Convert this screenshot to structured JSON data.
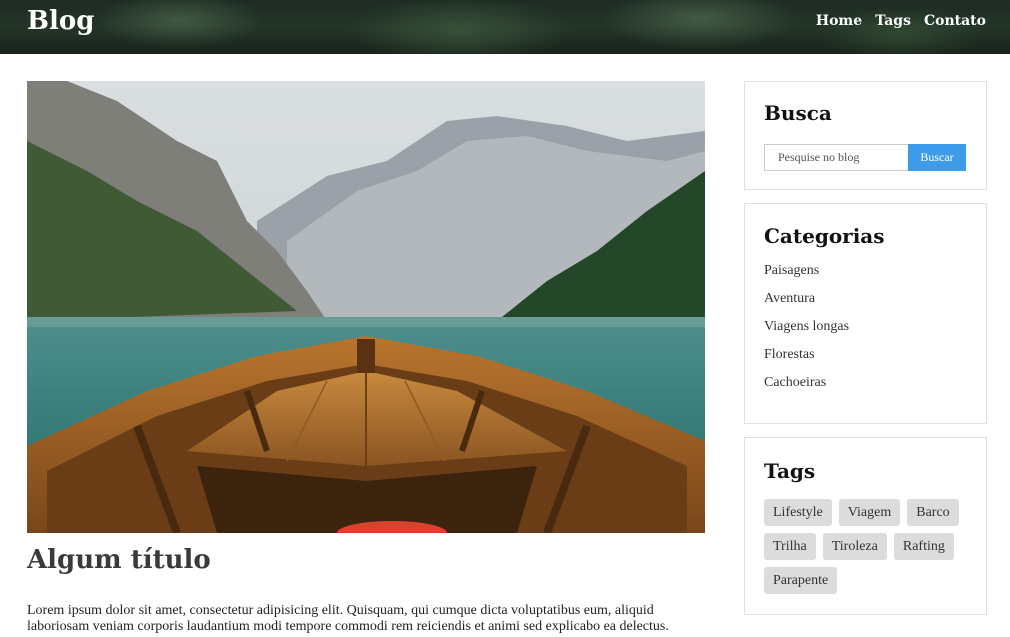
{
  "header": {
    "logo": "Blog",
    "nav": [
      {
        "label": "Home"
      },
      {
        "label": "Tags"
      },
      {
        "label": "Contato"
      }
    ]
  },
  "post": {
    "image_alt": "Barco em lago cercado por montanhas",
    "title": "Algum título",
    "excerpt": "Lorem ipsum dolor sit amet, consectetur adipisicing elit. Quisquam, qui cumque dicta voluptatibus eum, aliquid laboriosam veniam corporis laudantium modi tempore commodi rem reiciendis et animi sed explicabo ea delectus."
  },
  "sidebar": {
    "search": {
      "title": "Busca",
      "placeholder": "Pesquise no blog",
      "button": "Buscar",
      "button_color": "#3d9be9"
    },
    "categories": {
      "title": "Categorias",
      "items": [
        "Paisagens",
        "Aventura",
        "Viagens longas",
        "Florestas",
        "Cachoeiras"
      ]
    },
    "tags": {
      "title": "Tags",
      "items": [
        "Lifestyle",
        "Viagem",
        "Barco",
        "Trilha",
        "Tiroleza",
        "Rafting",
        "Parapente"
      ]
    }
  }
}
